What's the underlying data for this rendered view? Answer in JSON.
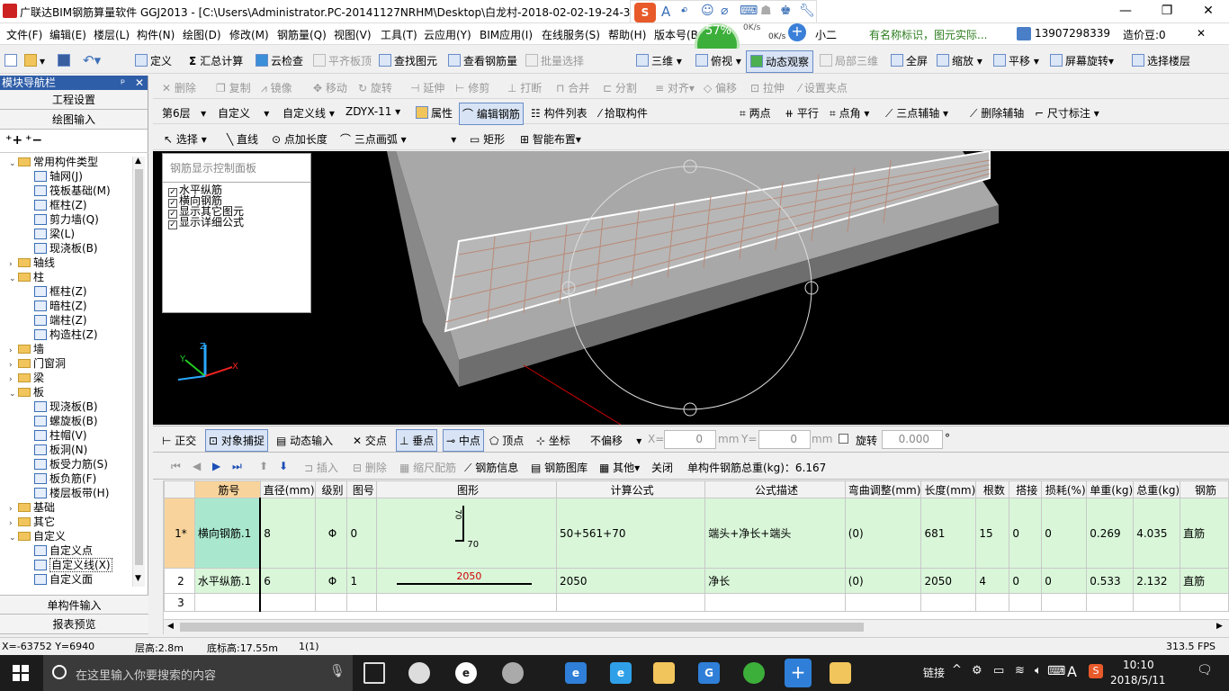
{
  "app": {
    "title": "广联达BIM钢筋算量软件 GGJ2013 - [C:\\Users\\Administrator.PC-20141127NRHM\\Desktop\\白龙村-2018-02-02-19-24-35",
    "min": "—",
    "max": "❐",
    "close": "✕"
  },
  "ime": {
    "cpu": "57%",
    "net_up": "0K/s",
    "net_down": "0K/s"
  },
  "menu": {
    "items": [
      "文件(F)",
      "编辑(E)",
      "楼层(L)",
      "构件(N)",
      "绘图(D)",
      "修改(M)",
      "钢筋量(Q)",
      "视图(V)",
      "工具(T)",
      "云应用(Y)",
      "BIM应用(I)",
      "在线服务(S)",
      "帮助(H)",
      "版本号(B"
    ],
    "extra": "小二",
    "notice": "有名称标识，图元实际...",
    "phone": "13907298339",
    "beans": "造价豆:0"
  },
  "toolbar1": {
    "define": "定义",
    "sum": "汇总计算",
    "cloud_check": "云检查",
    "align_top": "平齐板顶",
    "find": "查找图元",
    "view_rebar": "查看钢筋量",
    "batch": "批量选择",
    "three_d": "三维",
    "top_view": "俯视",
    "dyn_view": "动态观察",
    "local_3d": "局部三维",
    "fullscreen": "全屏",
    "zoom": "缩放",
    "pan": "平移",
    "rotate_screen": "屏幕旋转",
    "select_floor": "选择楼层"
  },
  "toolbar2": {
    "delete": "删除",
    "copy": "复制",
    "mirror": "镜像",
    "move": "移动",
    "rotate": "旋转",
    "extend": "延伸",
    "trim": "修剪",
    "break": "打断",
    "merge": "合并",
    "split": "分割",
    "align": "对齐",
    "offset": "偏移",
    "stretch": "拉伸",
    "grip": "设置夹点"
  },
  "toolbar3": {
    "floor": "第6层",
    "type": "自定义",
    "sub": "自定义线",
    "name": "ZDYX-11",
    "props": "属性",
    "edit_rebar": "编辑钢筋",
    "list": "构件列表",
    "pick": "拾取构件",
    "two_pt": "两点",
    "parallel": "平行",
    "pt_angle": "点角",
    "three_pt_axis": "三点辅轴",
    "del_axis": "删除辅轴",
    "dim": "尺寸标注"
  },
  "toolbar4": {
    "select": "选择",
    "line": "直线",
    "pt_len": "点加长度",
    "arc": "三点画弧",
    "rect": "矩形",
    "smart": "智能布置"
  },
  "nav": {
    "title": "模块导航栏",
    "pin": "ᵖ",
    "close": "✕",
    "btn_settings": "工程设置",
    "btn_draw": "绘图输入",
    "btn_single": "单构件输入",
    "btn_report": "报表预览",
    "tree": [
      {
        "l": "常用构件类型",
        "lv": 0,
        "t": "f",
        "o": "⊟"
      },
      {
        "l": "轴网(J)",
        "lv": 1
      },
      {
        "l": "筏板基础(M)",
        "lv": 1
      },
      {
        "l": "框柱(Z)",
        "lv": 1
      },
      {
        "l": "剪力墙(Q)",
        "lv": 1
      },
      {
        "l": "梁(L)",
        "lv": 1
      },
      {
        "l": "现浇板(B)",
        "lv": 1
      },
      {
        "l": "轴线",
        "lv": 0,
        "t": "f",
        "o": "⊞"
      },
      {
        "l": "柱",
        "lv": 0,
        "t": "f",
        "o": "⊟"
      },
      {
        "l": "框柱(Z)",
        "lv": 1
      },
      {
        "l": "暗柱(Z)",
        "lv": 1
      },
      {
        "l": "端柱(Z)",
        "lv": 1
      },
      {
        "l": "构造柱(Z)",
        "lv": 1
      },
      {
        "l": "墙",
        "lv": 0,
        "t": "f",
        "o": "⊞"
      },
      {
        "l": "门窗洞",
        "lv": 0,
        "t": "f",
        "o": "⊞"
      },
      {
        "l": "梁",
        "lv": 0,
        "t": "f",
        "o": "⊞"
      },
      {
        "l": "板",
        "lv": 0,
        "t": "f",
        "o": "⊟"
      },
      {
        "l": "现浇板(B)",
        "lv": 1
      },
      {
        "l": "螺旋板(B)",
        "lv": 1
      },
      {
        "l": "柱帽(V)",
        "lv": 1
      },
      {
        "l": "板洞(N)",
        "lv": 1
      },
      {
        "l": "板受力筋(S)",
        "lv": 1
      },
      {
        "l": "板负筋(F)",
        "lv": 1
      },
      {
        "l": "楼层板带(H)",
        "lv": 1
      },
      {
        "l": "基础",
        "lv": 0,
        "t": "f",
        "o": "⊞"
      },
      {
        "l": "其它",
        "lv": 0,
        "t": "f",
        "o": "⊞"
      },
      {
        "l": "自定义",
        "lv": 0,
        "t": "f",
        "o": "⊟"
      },
      {
        "l": "自定义点",
        "lv": 1
      },
      {
        "l": "自定义线(X)",
        "lv": 1,
        "sel": true
      },
      {
        "l": "自定义面",
        "lv": 1
      }
    ]
  },
  "ctrlpanel": {
    "title": "钢筋显示控制面板",
    "opts": [
      "水平纵筋",
      "横向钢筋",
      "显示其它图元",
      "显示详细公式"
    ]
  },
  "snap": {
    "ortho": "正交",
    "osnap": "对象捕捉",
    "dyn_input": "动态输入",
    "intersect": "交点",
    "perp": "垂点",
    "mid": "中点",
    "vertex": "顶点",
    "coord": "坐标",
    "offset_mode": "不偏移",
    "x_label": "X=",
    "x_val": "0",
    "mm1": "mm",
    "y_label": "Y=",
    "y_val": "0",
    "mm2": "mm",
    "rot_label": "旋转",
    "rot_val": "0.000",
    "deg": "°"
  },
  "rebarbar": {
    "insert": "插入",
    "delete": "删除",
    "scale": "缩尺配筋",
    "info": "钢筋信息",
    "lib": "钢筋图库",
    "other": "其他",
    "close": "关闭",
    "total": "单构件钢筋总重(kg)：6.167"
  },
  "grid": {
    "headers": [
      "",
      "筋号",
      "直径(mm)",
      "级别",
      "图号",
      "图形",
      "计算公式",
      "公式描述",
      "弯曲调整(mm)",
      "长度(mm)",
      "根数",
      "搭接",
      "损耗(%)",
      "单重(kg)",
      "总重(kg)",
      "钢筋"
    ],
    "rows": [
      {
        "no": "1*",
        "name": "横向钢筋.1",
        "d": "8",
        "grade": "Φ",
        "fig": "0",
        "shape_a": "70",
        "shape_b": "70",
        "formula": "50+561+70",
        "desc": "端头+净长+端头",
        "bend": "(0)",
        "len": "681",
        "count": "15",
        "lap": "0",
        "loss": "0",
        "unit": "0.269",
        "total": "4.035",
        "type": "直筋"
      },
      {
        "no": "2",
        "name": "水平纵筋.1",
        "d": "6",
        "grade": "Φ",
        "fig": "1",
        "shape_a": "2050",
        "shape_b": "",
        "formula": "2050",
        "desc": "净长",
        "bend": "(0)",
        "len": "2050",
        "count": "4",
        "lap": "0",
        "loss": "0",
        "unit": "0.533",
        "total": "2.132",
        "type": "直筋"
      },
      {
        "no": "3",
        "name": "",
        "d": "",
        "grade": "",
        "fig": "",
        "shape_a": "",
        "shape_b": "",
        "formula": "",
        "desc": "",
        "bend": "",
        "len": "",
        "count": "",
        "lap": "",
        "loss": "",
        "unit": "",
        "total": "",
        "type": ""
      }
    ]
  },
  "status": {
    "coord": "X=-63752 Y=6940",
    "floor_h": "层高:2.8m",
    "bottom_h": "底标高:17.55m",
    "count": "1(1)",
    "fps": "313.5 FPS"
  },
  "taskbar": {
    "search": "在这里输入你要搜索的内容",
    "link": "链接",
    "ime": "A",
    "time": "10:10",
    "date": "2018/5/11"
  },
  "colors": {
    "nav_head": "#2f5ea8",
    "viewport": "#000000",
    "row_green": "#d9f6d9",
    "name_cell": "#a9e8cf",
    "num_cell": "#f8d49c"
  }
}
